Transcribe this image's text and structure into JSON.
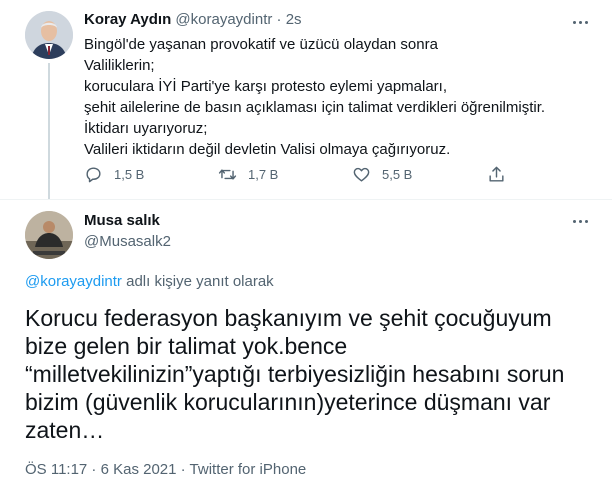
{
  "tweet1": {
    "author_name": "Koray Aydın",
    "handle": "@korayaydintr",
    "separator": "·",
    "time": "2s",
    "lines": [
      "Bingöl'de yaşanan provokatif ve üzücü olaydan sonra",
      "Valiliklerin;",
      "koruculara İYİ Parti'ye karşı protesto eylemi yapmaları,",
      "şehit ailelerine de basın açıklaması için talimat verdikleri öğrenilmiştir.",
      "İktidarı uyarıyoruz;",
      "Valileri iktidarın değil devletin Valisi olmaya çağırıyoruz."
    ],
    "reply_count": "1,5 B",
    "retweet_count": "1,7 B",
    "like_count": "5,5 B"
  },
  "tweet2": {
    "author_name": "Musa salık",
    "handle": "@Musasalk2",
    "reply_mention": "@korayaydintr",
    "reply_suffix": " adlı kişiye yanıt olarak",
    "lines": [
      "Korucu federasyon başkanıyım  ve şehit çocuğuyum",
      "bize gelen bir talimat yok.bence",
      "“milletvekilinizin”yaptığı terbiyesizliğin hesabını sorun",
      "bizim (güvenlik korucularının)yeterince düşmanı var",
      "zaten…"
    ],
    "meta": "ÖS 11:17 · 6 Kas 2021 · Twitter for iPhone"
  },
  "icons": {
    "more": "more-icon",
    "reply": "reply-icon",
    "retweet": "retweet-icon",
    "like": "like-icon",
    "share": "share-icon"
  },
  "colors": {
    "text": "#0f1419",
    "muted": "#536471",
    "link": "#1d9bf0",
    "divider": "#eff3f4"
  }
}
